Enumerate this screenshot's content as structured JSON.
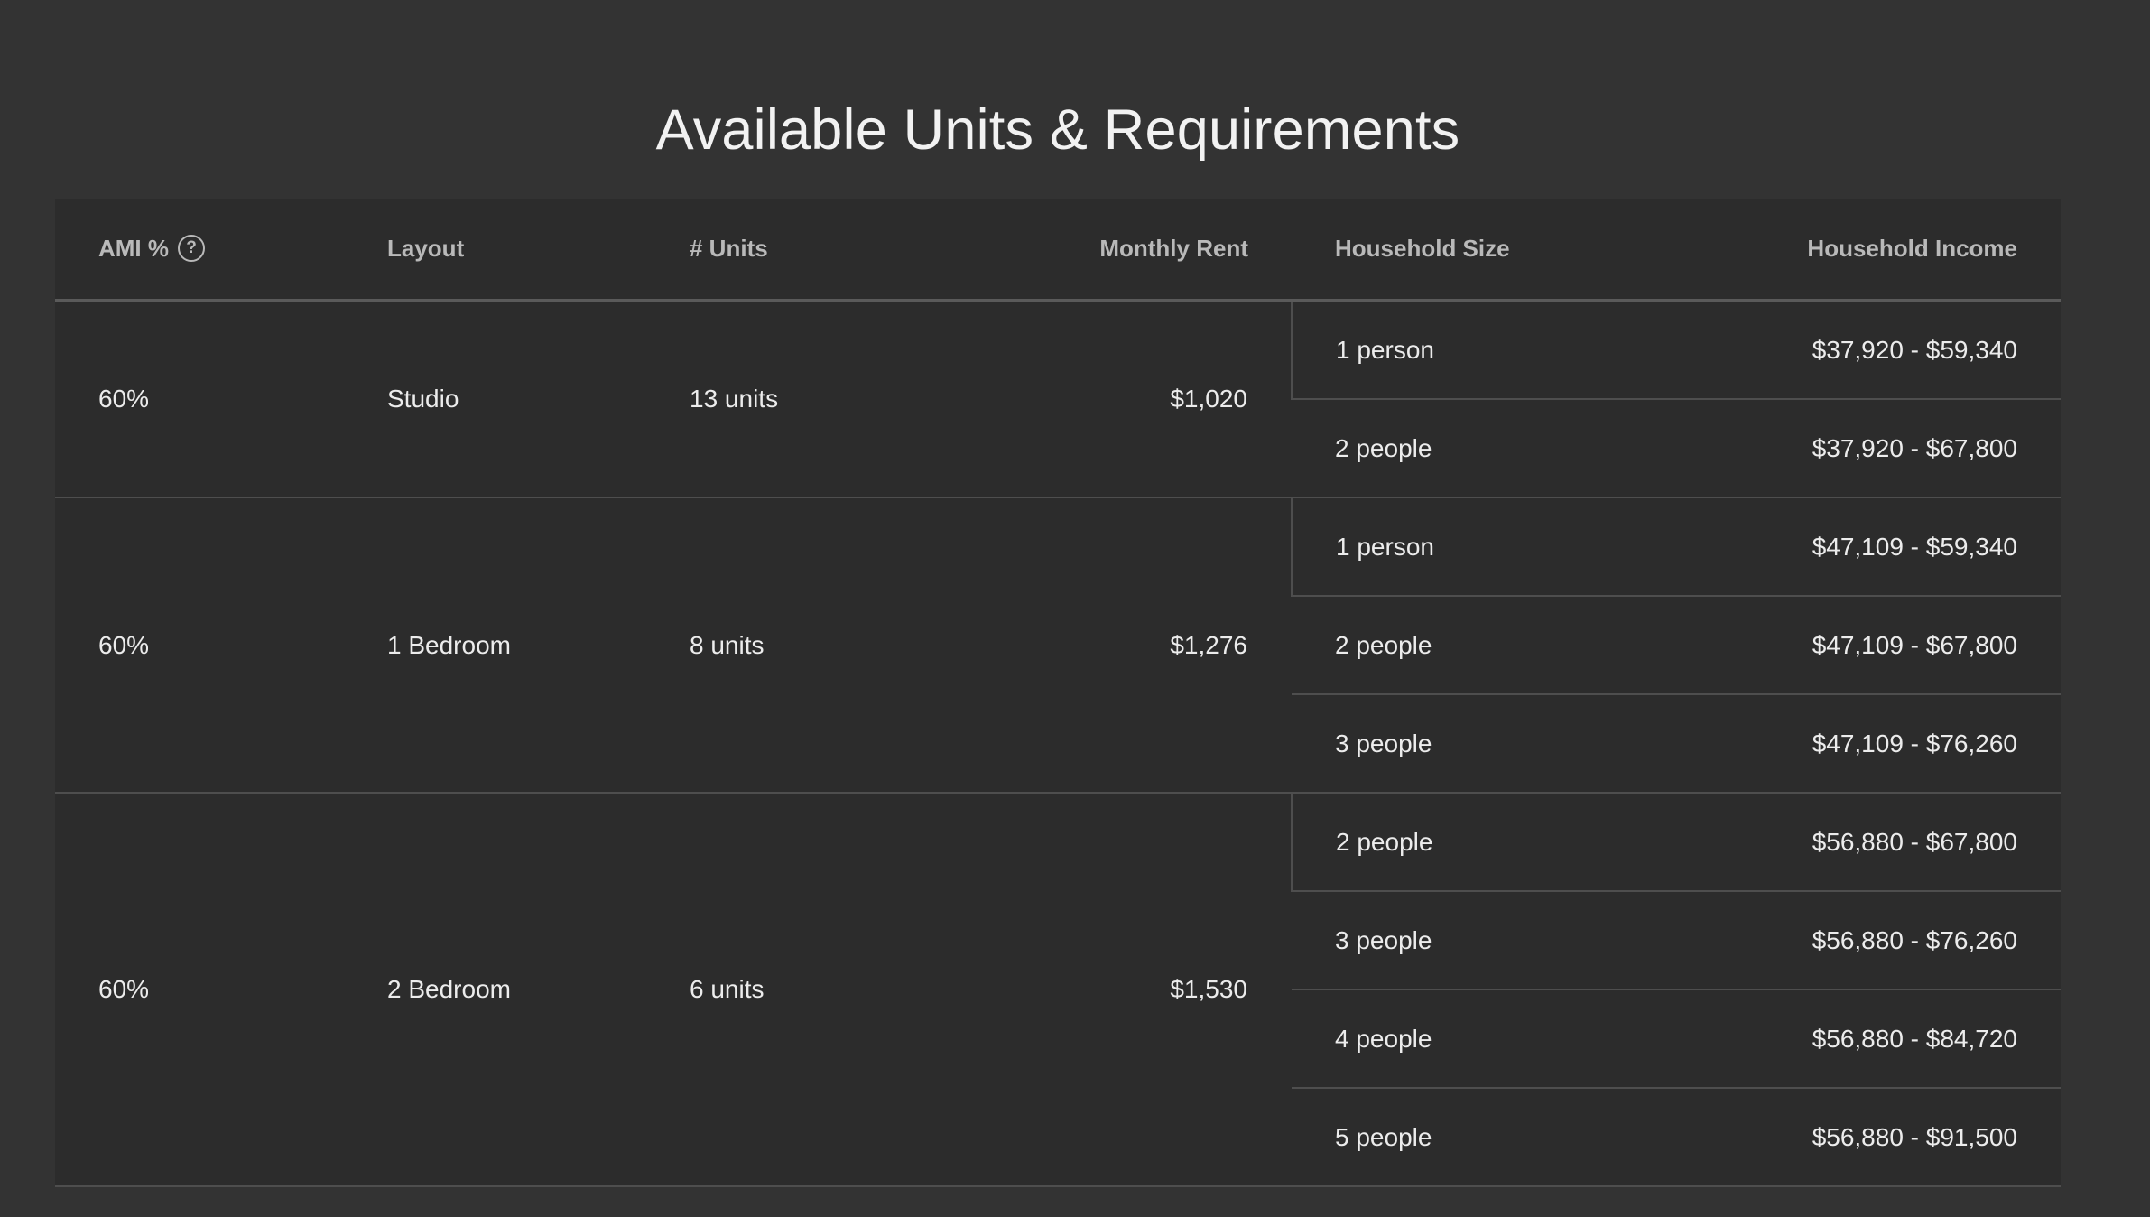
{
  "page": {
    "title": "Available Units & Requirements"
  },
  "table": {
    "headers": {
      "ami": "AMI %",
      "ami_help_icon": "question-circle-icon",
      "layout": "Layout",
      "units": "# Units",
      "rent": "Monthly Rent",
      "household_size": "Household Size",
      "household_income": "Household Income"
    },
    "groups": [
      {
        "ami": "60%",
        "layout": "Studio",
        "units": "13 units",
        "rent": "$1,020",
        "rows": [
          {
            "size": "1 person",
            "income": "$37,920 - $59,340"
          },
          {
            "size": "2 people",
            "income": "$37,920 - $67,800"
          }
        ]
      },
      {
        "ami": "60%",
        "layout": "1 Bedroom",
        "units": "8 units",
        "rent": "$1,276",
        "rows": [
          {
            "size": "1 person",
            "income": "$47,109 - $59,340"
          },
          {
            "size": "2 people",
            "income": "$47,109 - $67,800"
          },
          {
            "size": "3 people",
            "income": "$47,109 - $76,260"
          }
        ]
      },
      {
        "ami": "60%",
        "layout": "2 Bedroom",
        "units": "6 units",
        "rent": "$1,530",
        "rows": [
          {
            "size": "2 people",
            "income": "$56,880 - $67,800"
          },
          {
            "size": "3 people",
            "income": "$56,880 - $76,260"
          },
          {
            "size": "4 people",
            "income": "$56,880 - $84,720"
          },
          {
            "size": "5 people",
            "income": "$56,880 - $91,500"
          }
        ]
      }
    ]
  },
  "colors": {
    "background": "#333333",
    "table_background": "#2c2c2c",
    "header_text": "#b9b9b9",
    "body_text": "#ececec",
    "divider": "#4e4e4e"
  }
}
